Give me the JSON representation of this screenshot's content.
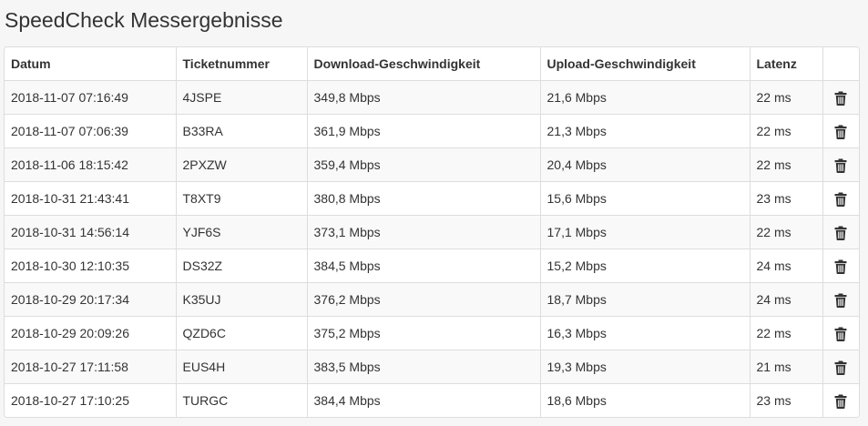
{
  "page": {
    "title": "SpeedCheck Messergebnisse"
  },
  "table": {
    "headers": {
      "datum": "Datum",
      "ticket": "Ticketnummer",
      "download": "Download-Geschwindigkeit",
      "upload": "Upload-Geschwindigkeit",
      "latency": "Latenz"
    },
    "rows": [
      {
        "datum": "2018-11-07 07:16:49",
        "ticket": "4JSPE",
        "download": "349,8 Mbps",
        "upload": "21,6 Mbps",
        "latency": "22 ms",
        "action_icon": "trash-icon"
      },
      {
        "datum": "2018-11-07 07:06:39",
        "ticket": "B33RA",
        "download": "361,9 Mbps",
        "upload": "21,3 Mbps",
        "latency": "22 ms",
        "action_icon": "trash-icon"
      },
      {
        "datum": "2018-11-06 18:15:42",
        "ticket": "2PXZW",
        "download": "359,4 Mbps",
        "upload": "20,4 Mbps",
        "latency": "22 ms",
        "action_icon": "trash-icon"
      },
      {
        "datum": "2018-10-31 21:43:41",
        "ticket": "T8XT9",
        "download": "380,8 Mbps",
        "upload": "15,6 Mbps",
        "latency": "23 ms",
        "action_icon": "trash-icon"
      },
      {
        "datum": "2018-10-31 14:56:14",
        "ticket": "YJF6S",
        "download": "373,1 Mbps",
        "upload": "17,1 Mbps",
        "latency": "22 ms",
        "action_icon": "trash-icon"
      },
      {
        "datum": "2018-10-30 12:10:35",
        "ticket": "DS32Z",
        "download": "384,5 Mbps",
        "upload": "15,2 Mbps",
        "latency": "24 ms",
        "action_icon": "trash-icon"
      },
      {
        "datum": "2018-10-29 20:17:34",
        "ticket": "K35UJ",
        "download": "376,2 Mbps",
        "upload": "18,7 Mbps",
        "latency": "24 ms",
        "action_icon": "trash-icon"
      },
      {
        "datum": "2018-10-29 20:09:26",
        "ticket": "QZD6C",
        "download": "375,2 Mbps",
        "upload": "16,3 Mbps",
        "latency": "22 ms",
        "action_icon": "trash-icon"
      },
      {
        "datum": "2018-10-27 17:11:58",
        "ticket": "EUS4H",
        "download": "383,5 Mbps",
        "upload": "19,3 Mbps",
        "latency": "21 ms",
        "action_icon": "trash-icon"
      },
      {
        "datum": "2018-10-27 17:10:25",
        "ticket": "TURGC",
        "download": "384,4 Mbps",
        "upload": "18,6 Mbps",
        "latency": "23 ms",
        "action_icon": "trash-icon"
      }
    ]
  },
  "colors": {
    "background": "#f6f6f6",
    "text": "#333333",
    "border": "#dddddd",
    "stripe": "#f9f9f9",
    "icon": "#333333"
  }
}
